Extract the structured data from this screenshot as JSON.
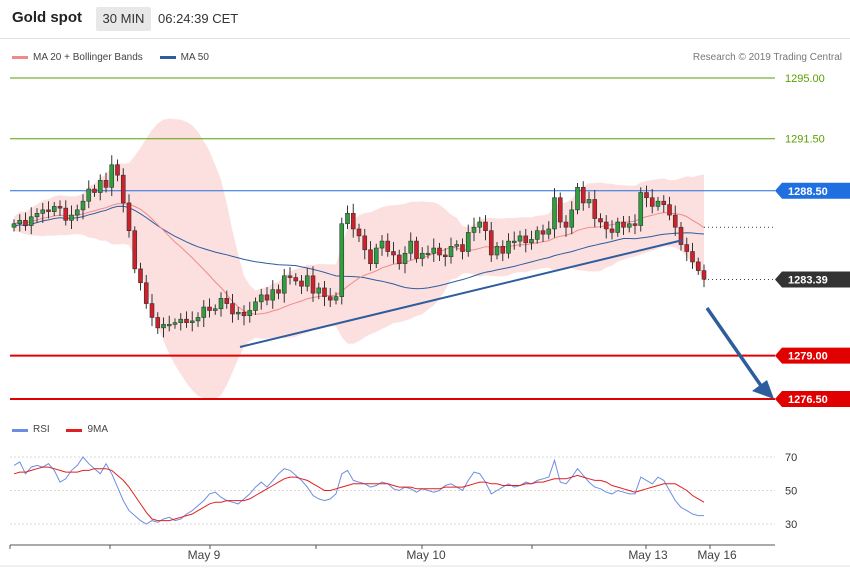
{
  "header": {
    "title": "Gold spot",
    "timeframe": "30 MIN",
    "time": "06:24:39 CET"
  },
  "legend": {
    "ma20": "MA 20 + Bollinger Bands",
    "ma50": "MA 50",
    "ma20_color": "#f08a8a",
    "ma50_color": "#2e5d9e"
  },
  "copyright": "Research © 2019 Trading Central",
  "rsi_legend": {
    "rsi": "RSI",
    "ma": "9MA",
    "rsi_color": "#6d8ee0",
    "ma_color": "#e02020"
  },
  "chart_data": [
    {
      "type": "candlestick",
      "title": "Gold spot 30 MIN",
      "ylim": [
        1273,
        1297
      ],
      "price_levels": [
        {
          "value": 1295.0,
          "label": "1295.00",
          "color": "#5aa000",
          "style": "green-line"
        },
        {
          "value": 1291.5,
          "label": "1291.50",
          "color": "#5aa000",
          "style": "green-line"
        },
        {
          "value": 1288.5,
          "label": "1288.50",
          "color": "#1f6fe0",
          "style": "blue-line"
        },
        {
          "value": 1283.39,
          "label": "1283.39",
          "color": "#333333",
          "style": "current-price"
        },
        {
          "value": 1279.0,
          "label": "1279.00",
          "color": "#e00000",
          "style": "red-line"
        },
        {
          "value": 1276.5,
          "label": "1276.50",
          "color": "#e00000",
          "style": "red-line"
        }
      ],
      "x_tick_labels": [
        "May 9",
        "May 10",
        "May 13",
        "May 16"
      ],
      "closes": [
        1286.6,
        1286.8,
        1286.5,
        1287.0,
        1287.2,
        1287.4,
        1287.3,
        1287.6,
        1287.5,
        1286.8,
        1287.1,
        1287.4,
        1287.9,
        1288.6,
        1288.4,
        1289.1,
        1288.7,
        1290.0,
        1289.4,
        1287.8,
        1286.2,
        1284.0,
        1283.2,
        1282.0,
        1281.2,
        1280.6,
        1280.8,
        1280.8,
        1280.9,
        1281.1,
        1280.9,
        1281.0,
        1281.2,
        1281.8,
        1281.6,
        1281.7,
        1282.3,
        1282.0,
        1281.4,
        1281.5,
        1281.3,
        1281.6,
        1282.1,
        1282.5,
        1282.2,
        1282.8,
        1282.6,
        1283.6,
        1283.5,
        1283.3,
        1283.0,
        1283.6,
        1282.6,
        1282.9,
        1282.4,
        1282.2,
        1282.4,
        1286.6,
        1287.2,
        1286.3,
        1285.9,
        1285.1,
        1284.3,
        1285.2,
        1285.6,
        1285.0,
        1284.8,
        1284.3,
        1284.9,
        1285.6,
        1284.6,
        1284.9,
        1284.9,
        1285.2,
        1284.8,
        1284.7,
        1285.3,
        1285.4,
        1285.0,
        1286.1,
        1286.4,
        1286.7,
        1286.2,
        1284.8,
        1285.3,
        1284.9,
        1285.6,
        1285.6,
        1285.9,
        1285.5,
        1285.7,
        1286.2,
        1286.0,
        1286.3,
        1288.1,
        1286.7,
        1286.4,
        1287.4,
        1288.7,
        1287.8,
        1288.0,
        1286.9,
        1286.7,
        1286.3,
        1286.1,
        1286.7,
        1286.4,
        1286.6,
        1286.5,
        1288.4,
        1288.1,
        1287.6,
        1287.9,
        1287.7,
        1287.1,
        1286.4,
        1285.4,
        1285.0,
        1284.4,
        1283.9,
        1283.4
      ],
      "current_price": 1283.39,
      "projection": {
        "from": 1283.39,
        "to": 1276.5,
        "direction": "down"
      },
      "support_trendline": true
    },
    {
      "type": "line",
      "title": "RSI",
      "ylim": [
        25,
        75
      ],
      "y_ticks": [
        30,
        50,
        70
      ],
      "series": [
        {
          "name": "RSI",
          "values": [
            65,
            67,
            60,
            64,
            65,
            64,
            66,
            62,
            55,
            57,
            62,
            65,
            70,
            66,
            63,
            60,
            66,
            60,
            52,
            44,
            38,
            35,
            32,
            30,
            32,
            31,
            33,
            34,
            32,
            33,
            36,
            38,
            41,
            44,
            48,
            49,
            46,
            44,
            43,
            42,
            45,
            48,
            52,
            55,
            52,
            56,
            60,
            63,
            62,
            59,
            56,
            52,
            47,
            45,
            44,
            45,
            48,
            60,
            62,
            56,
            55,
            54,
            52,
            53,
            55,
            54,
            51,
            50,
            52,
            51,
            49,
            51,
            50,
            49,
            50,
            53,
            54,
            52,
            50,
            56,
            61,
            60,
            55,
            48,
            50,
            52,
            54,
            52,
            53,
            55,
            54,
            56,
            57,
            58,
            68,
            55,
            54,
            58,
            63,
            59,
            55,
            52,
            51,
            49,
            48,
            50,
            49,
            48,
            48,
            58,
            56,
            54,
            58,
            56,
            50,
            44,
            40,
            38,
            36,
            35,
            35
          ]
        },
        {
          "name": "9MA",
          "values": [
            60,
            61,
            61,
            62,
            63,
            64,
            64,
            63,
            62,
            61,
            61,
            61,
            62,
            62,
            63,
            63,
            63,
            62,
            59,
            56,
            52,
            47,
            42,
            37,
            33,
            32,
            32,
            32,
            33,
            34,
            35,
            36,
            38,
            40,
            42,
            43,
            43,
            44,
            44,
            44,
            44,
            45,
            47,
            49,
            51,
            53,
            55,
            57,
            58,
            58,
            57,
            56,
            54,
            52,
            50,
            50,
            51,
            52,
            53,
            54,
            54,
            54,
            54,
            54,
            54,
            54,
            53,
            52,
            52,
            52,
            51,
            51,
            51,
            51,
            51,
            52,
            52,
            52,
            52,
            53,
            54,
            55,
            55,
            54,
            54,
            53,
            53,
            53,
            53,
            54,
            54,
            55,
            55,
            56,
            57,
            57,
            57,
            58,
            59,
            58,
            57,
            56,
            56,
            55,
            53,
            52,
            51,
            50,
            49,
            50,
            51,
            52,
            53,
            54,
            54,
            54,
            52,
            50,
            47,
            45,
            43
          ]
        }
      ]
    }
  ]
}
